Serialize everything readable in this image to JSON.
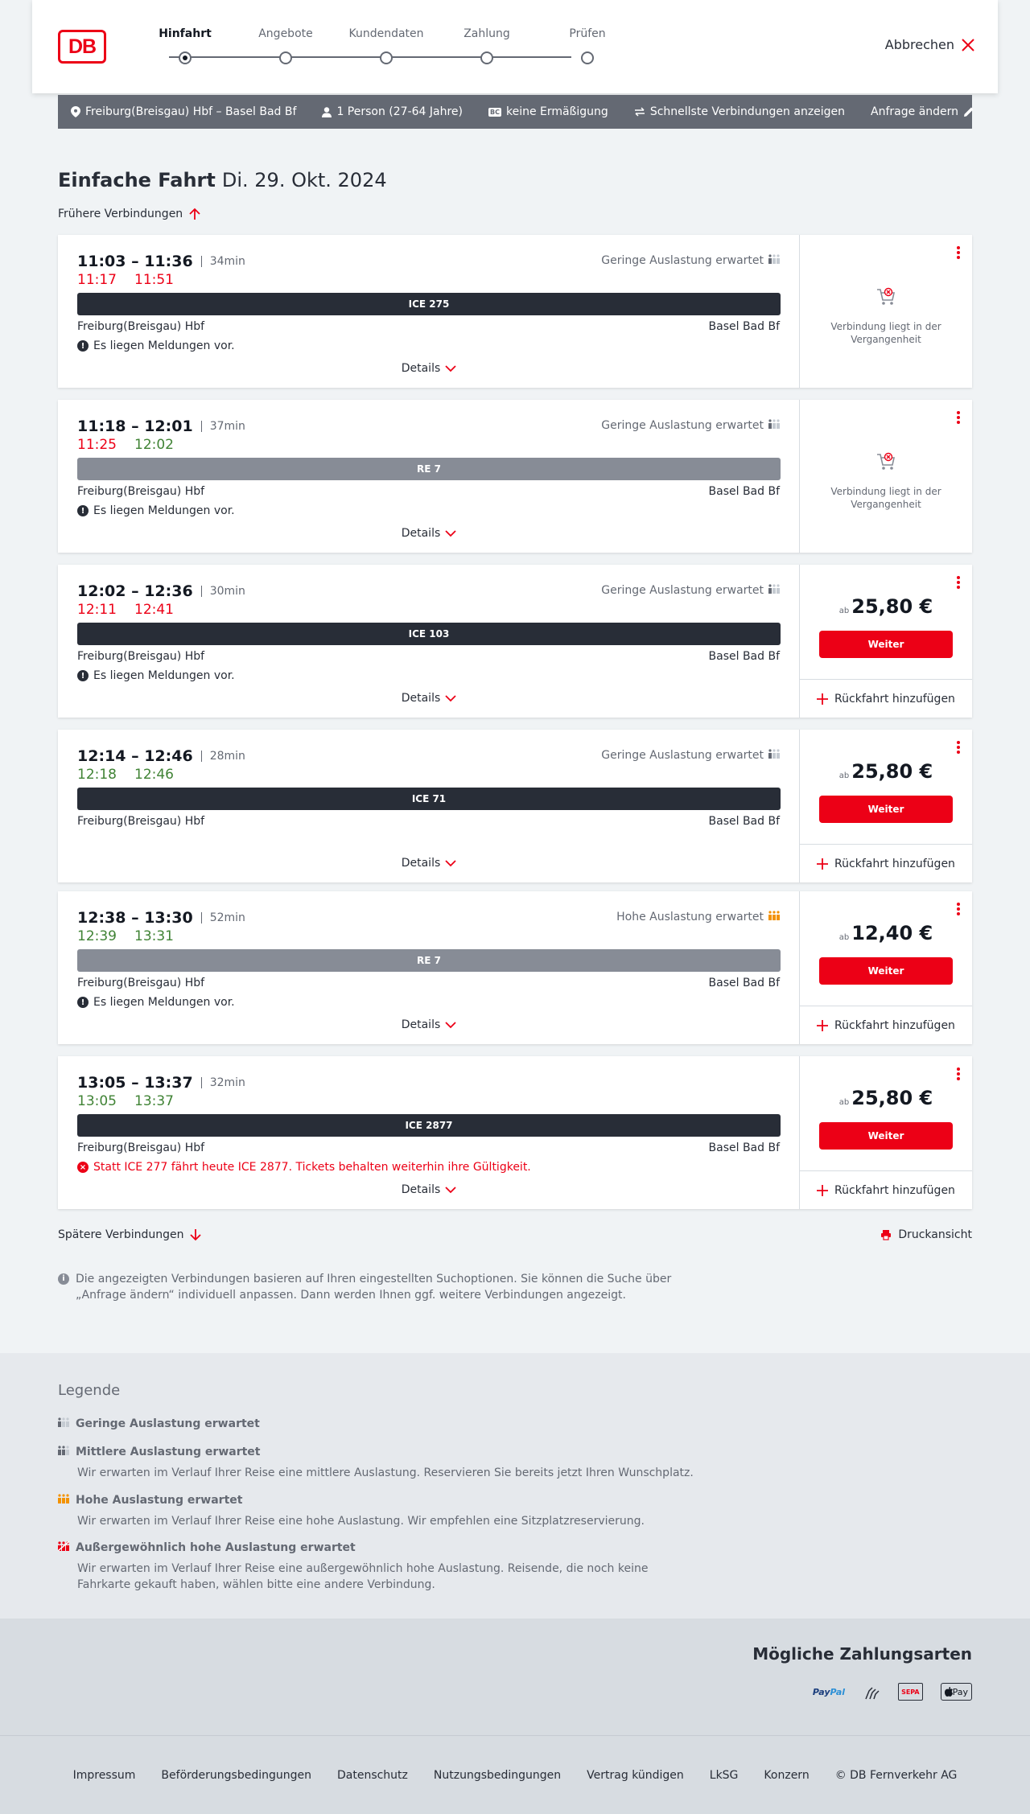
{
  "header": {
    "logo": "DB",
    "steps": [
      "Hinfahrt",
      "Angebote",
      "Kundendaten",
      "Zahlung",
      "Prüfen"
    ],
    "cancel": "Abbrechen"
  },
  "search": {
    "route": "Freiburg(Breisgau) Hbf – Basel Bad Bf",
    "travellers": "1 Person (27-64 Jahre)",
    "discount_badge": "BC",
    "discount": "keine Ermäßigung",
    "fastest": "Schnellste Verbindungen anzeigen",
    "change": "Anfrage ändern"
  },
  "page": {
    "title": "Einfache Fahrt",
    "date": "Di. 29. Okt. 2024",
    "earlier": "Frühere Verbindungen",
    "later": "Spätere Verbindungen",
    "print": "Druckansicht",
    "info": "Die angezeigten Verbindungen basieren auf Ihren eingestellten Suchoptionen. Sie können die Suche über „Anfrage ändern“ individuell anpassen. Dann werden Ihnen ggf. weitere Verbindungen angezeigt."
  },
  "labels": {
    "details": "Details",
    "weiter": "Weiter",
    "rueckfahrt": "Rückfahrt hinzufügen",
    "ab": "ab",
    "past": "Verbindung liegt in der Vergangenheit"
  },
  "connections": [
    {
      "times": "11:03 – 11:36",
      "duration": "34min",
      "rt_dep": "11:17",
      "rt_arr": "11:51",
      "rt_dep_status": "late",
      "rt_arr_status": "late",
      "occupancy": "Geringe Auslastung erwartet",
      "occ_level": "low",
      "train": "ICE 275",
      "train_type": "ice",
      "from": "Freiburg(Breisgau) Hbf",
      "to": "Basel Bad Bf",
      "message": "Es liegen Meldungen vor.",
      "message_type": "info",
      "past": true,
      "price": ""
    },
    {
      "times": "11:18 – 12:01",
      "duration": "37min",
      "rt_dep": "11:25",
      "rt_arr": "12:02",
      "rt_dep_status": "late",
      "rt_arr_status": "ontime",
      "occupancy": "Geringe Auslastung erwartet",
      "occ_level": "low",
      "train": "RE 7",
      "train_type": "re",
      "from": "Freiburg(Breisgau) Hbf",
      "to": "Basel Bad Bf",
      "message": "Es liegen Meldungen vor.",
      "message_type": "info",
      "past": true,
      "price": ""
    },
    {
      "times": "12:02 – 12:36",
      "duration": "30min",
      "rt_dep": "12:11",
      "rt_arr": "12:41",
      "rt_dep_status": "late",
      "rt_arr_status": "late",
      "occupancy": "Geringe Auslastung erwartet",
      "occ_level": "low",
      "train": "ICE 103",
      "train_type": "ice",
      "from": "Freiburg(Breisgau) Hbf",
      "to": "Basel Bad Bf",
      "message": "Es liegen Meldungen vor.",
      "message_type": "info",
      "past": false,
      "price": "25,80 €"
    },
    {
      "times": "12:14 – 12:46",
      "duration": "28min",
      "rt_dep": "12:18",
      "rt_arr": "12:46",
      "rt_dep_status": "ontime",
      "rt_arr_status": "ontime",
      "occupancy": "Geringe Auslastung erwartet",
      "occ_level": "low",
      "train": "ICE 71",
      "train_type": "ice",
      "from": "Freiburg(Breisgau) Hbf",
      "to": "Basel Bad Bf",
      "message": "",
      "message_type": "none",
      "past": false,
      "price": "25,80 €"
    },
    {
      "times": "12:38 – 13:30",
      "duration": "52min",
      "rt_dep": "12:39",
      "rt_arr": "13:31",
      "rt_dep_status": "ontime",
      "rt_arr_status": "ontime",
      "occupancy": "Hohe Auslastung erwartet",
      "occ_level": "high",
      "train": "RE 7",
      "train_type": "re",
      "from": "Freiburg(Breisgau) Hbf",
      "to": "Basel Bad Bf",
      "message": "Es liegen Meldungen vor.",
      "message_type": "info",
      "past": false,
      "price": "12,40 €"
    },
    {
      "times": "13:05 – 13:37",
      "duration": "32min",
      "rt_dep": "13:05",
      "rt_arr": "13:37",
      "rt_dep_status": "ontime",
      "rt_arr_status": "ontime",
      "occupancy": "",
      "occ_level": "none",
      "train": "ICE 2877",
      "train_type": "ice",
      "from": "Freiburg(Breisgau) Hbf",
      "to": "Basel Bad Bf",
      "message": "Statt ICE 277 fährt heute ICE 2877. Tickets behalten weiterhin ihre Gültigkeit.",
      "message_type": "error",
      "past": false,
      "price": "25,80 €"
    }
  ],
  "legend": {
    "title": "Legende",
    "items": [
      {
        "title": "Geringe Auslastung erwartet",
        "text": "",
        "level": "low"
      },
      {
        "title": "Mittlere Auslastung erwartet",
        "text": "Wir erwarten im Verlauf Ihrer Reise eine mittlere Auslastung. Reservieren Sie bereits jetzt Ihren Wunschplatz.",
        "level": "mid"
      },
      {
        "title": "Hohe Auslastung erwartet",
        "text": "Wir erwarten im Verlauf Ihrer Reise eine hohe Auslastung. Wir empfehlen eine Sitzplatzreservierung.",
        "level": "high"
      },
      {
        "title": "Außergewöhnlich hohe Auslastung erwartet",
        "text": "Wir erwarten im Verlauf Ihrer Reise eine außergewöhnlich hohe Auslastung. Reisende, die noch keine Fahrkarte gekauft haben, wählen bitte eine andere Verbindung.",
        "level": "extreme"
      }
    ]
  },
  "payment": {
    "title": "Mögliche Zahlungsarten",
    "paypal_a": "Pay",
    "paypal_b": "Pal",
    "sepa": "SEPA",
    "applepay": "Pay"
  },
  "colors": {
    "accent": "#ec0016",
    "late": "#ec0016",
    "ontime": "#408335",
    "high_occupancy": "#f39200"
  },
  "footer": [
    "Impressum",
    "Beförderungsbedingungen",
    "Datenschutz",
    "Nutzungsbedingungen",
    "Vertrag kündigen",
    "LkSG",
    "Konzern",
    "© DB Fernverkehr AG"
  ]
}
